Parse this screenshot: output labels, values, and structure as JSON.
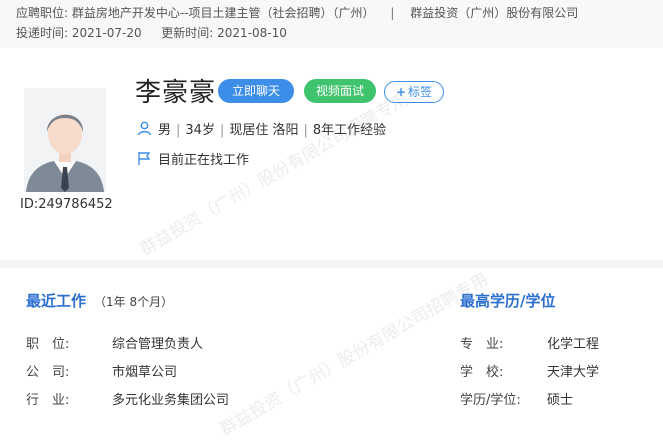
{
  "header": {
    "applied_position_label": "应聘职位:",
    "applied_position_value": "群益房地产开发中心--项目土建主管（社会招聘）（广州）",
    "separator": "|",
    "company": "群益投资（广州）股份有限公司",
    "submitted_label": "投递时间:",
    "submitted_date": "2021-07-20",
    "updated_label": "更新时间:",
    "updated_date": "2021-08-10"
  },
  "profile": {
    "name": "李豪豪",
    "id_label": "ID:249786452",
    "chat_button": "立即聊天",
    "video_button": "视频面试",
    "tag_button": "标签",
    "gender": "男",
    "age": "34岁",
    "residence": "现居住 洛阳",
    "experience": "8年工作经验",
    "job_status": "目前正在找工作",
    "accent_color": "#3d8ee8"
  },
  "recent_work": {
    "title": "最近工作",
    "duration": "（1年 8个月）",
    "rows": [
      {
        "label": "职　位:",
        "value": "综合管理负责人"
      },
      {
        "label": "公　司:",
        "value": "市烟草公司"
      },
      {
        "label": "行　业:",
        "value": "多元化业务集团公司"
      }
    ]
  },
  "education": {
    "title": "最高学历/学位",
    "rows": [
      {
        "label": "专　业:",
        "value": "化学工程"
      },
      {
        "label": "学　校:",
        "value": "天津大学"
      },
      {
        "label": "学历/学位:",
        "value": "硕士"
      }
    ]
  },
  "watermarks": [
    "群益投资（广州）股份有限公司招聘专用",
    "群益投资（广州）股份有限公司招聘专用"
  ]
}
